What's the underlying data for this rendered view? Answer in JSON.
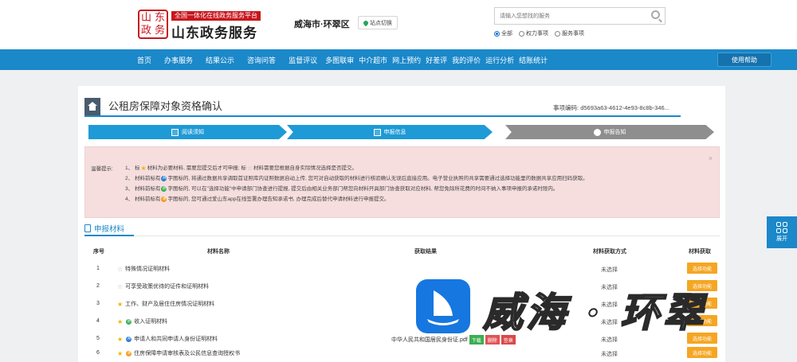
{
  "header": {
    "logo_chars": [
      "山",
      "东",
      "政",
      "务"
    ],
    "slogan": "全国一体化在线政务服务平台",
    "site_title": "山东政务服务",
    "region": "威海市·环翠区",
    "switch_label": "站点切换",
    "search_placeholder": "请输入您想找的服务",
    "scopes": [
      "全部",
      "权力事项",
      "服务事项"
    ],
    "scope_selected": "全部"
  },
  "nav": {
    "items": [
      "首页",
      "办事服务",
      "结果公示",
      "咨询问答",
      "监督评议",
      "多图联审",
      "中介超市",
      "网上预约",
      "好差评",
      "我的评价",
      "运行分析",
      "结账统计"
    ],
    "help_label": "使用帮助"
  },
  "page": {
    "title": "公租房保障对象资格确认",
    "item_code_label": "事项编码:",
    "item_code": "d5693a63-4612-4e93-8c8b-346...",
    "steps": [
      "阅读须知",
      "申报信息",
      "申报告知"
    ]
  },
  "notice": {
    "label": "温馨提示:",
    "lines": [
      {
        "num": "1、",
        "parts": [
          "标",
          "材料为必要材料, 需要您提交后才可申报; 标",
          "材料需要您根据自身实际情况选择是否提交。"
        ]
      },
      {
        "num": "2、",
        "parts": [
          "材料前标有",
          "字图标的, 将通过数据共享调取首证照库内证照数据自动上传, 您可对自动获取的材料进行核验确认无误后直接应用。电子营业执照的共享需要通过选择功能里的数据共享应用扫码获取。"
        ]
      },
      {
        "num": "3、",
        "parts": [
          "材料前标有",
          "字图标的, 可以在\"选择功能\"中申请部门协查进行提报, 提交后由相关业务部门帮您向材料开具部门协查获取对应材料, 帮您免除所花费的时间不纳入事项申报的承诺时限内。"
        ]
      },
      {
        "num": "4、",
        "parts": [
          "材料前标有",
          "字图标的, 您可通过爱山东app在线签署办理告知承诺书, 办理完成后替代申请材料进行申报提交。"
        ]
      }
    ],
    "dot_chars": [
      "共",
      "协",
      "承"
    ],
    "close": "×"
  },
  "materials": {
    "tab_label": "申报材料",
    "columns": [
      "序号",
      "材料名称",
      "获取结果",
      "材料获取方式",
      "材料获取"
    ],
    "rows": [
      {
        "no": "1",
        "name": "特殊情况证明材料",
        "star": "hollow",
        "dot": "",
        "result": "",
        "status": "未选择",
        "action": "选择功能"
      },
      {
        "no": "2",
        "name": "可享受政策优待的证件和证明材料",
        "star": "hollow",
        "dot": "",
        "result": "",
        "status": "未选择",
        "action": "选择功能"
      },
      {
        "no": "3",
        "name": "工作、财产及居住住房情况证明材料",
        "star": "solid",
        "dot": "",
        "result": "",
        "status": "未选择",
        "action": "选择功能"
      },
      {
        "no": "4",
        "name": "收入证明材料",
        "star": "solid",
        "dot": "green",
        "result": "",
        "status": "未选择",
        "action": "选择功能"
      },
      {
        "no": "5",
        "name": "申请人和共同申请人身份证明材料",
        "star": "solid",
        "dot": "blue",
        "result": "中华人民共和国居民身份证.pdf",
        "status": "未选择",
        "action": "选择功能",
        "result_buttons": [
          "下载",
          "删除",
          "签章"
        ]
      },
      {
        "no": "6",
        "name": "住房保障申请审核表及公民信息查询授权书",
        "star": "solid",
        "dot": "orange",
        "result": "",
        "status": "未选择",
        "action": "选择功能"
      }
    ]
  },
  "float": {
    "label": "展开"
  },
  "watermark": {
    "text": "威海 · 环翠"
  },
  "colors": {
    "primary": "#1a88c9",
    "brand_red": "#c8161d",
    "notice_bg": "#f6dede",
    "action_orange": "#f5a623"
  }
}
